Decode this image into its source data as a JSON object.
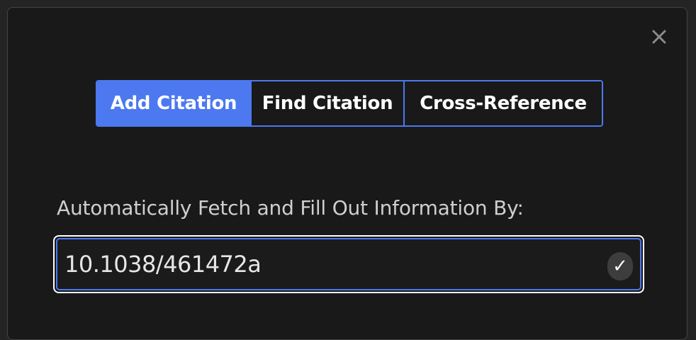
{
  "dialog": {
    "close_glyph": "✕"
  },
  "tabs": [
    {
      "label": "Add Citation",
      "active": true
    },
    {
      "label": "Find Citation",
      "active": false
    },
    {
      "label": "Cross-Reference",
      "active": false
    }
  ],
  "fetch": {
    "label": "Automatically Fetch and Fill Out Information By:",
    "value": "10.1038/461472a",
    "confirm_glyph": "✓"
  },
  "colors": {
    "accent": "#4c78f0",
    "background": "#191919",
    "text": "#ffffff"
  },
  "icons": {
    "close": "close-icon",
    "confirm": "checkmark-icon"
  }
}
